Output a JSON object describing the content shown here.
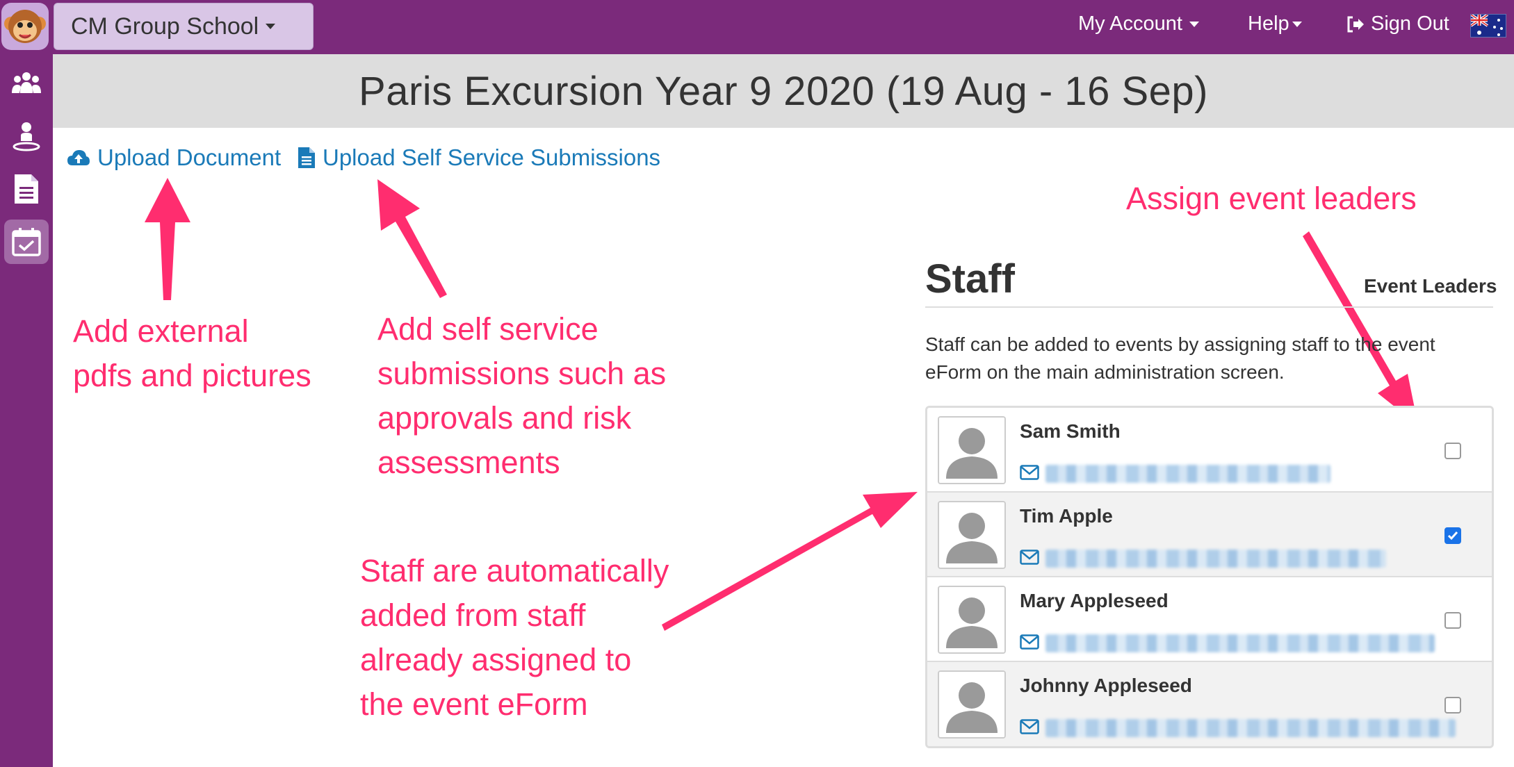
{
  "navbar": {
    "school_name": "CM Group School",
    "my_account": "My Account",
    "help": "Help",
    "sign_out": "Sign Out",
    "flag_icon": "australia-flag-icon"
  },
  "sidebar": {
    "items": [
      {
        "icon": "group-icon"
      },
      {
        "icon": "person-icon"
      },
      {
        "icon": "document-icon"
      },
      {
        "icon": "calendar-check-icon",
        "active": true
      }
    ]
  },
  "page": {
    "title": "Paris Excursion Year 9 2020 (19 Aug - 16 Sep)"
  },
  "actions": {
    "upload_document": "Upload Document",
    "upload_self_service": "Upload Self Service Submissions"
  },
  "annotations": {
    "external": [
      "Add external",
      "pdfs and pictures"
    ],
    "self_service": [
      "Add self service",
      "submissions such as",
      "approvals and risk",
      "assessments"
    ],
    "staff_auto": [
      "Staff are automatically",
      "added from staff",
      "already assigned to",
      "the event eForm"
    ],
    "leaders": [
      "Assign event leaders"
    ],
    "color": "#ff2d6f"
  },
  "staff": {
    "title": "Staff",
    "leaders_label": "Event Leaders",
    "description": "Staff can be added to events by assigning staff to the event eForm on the main administration screen.",
    "members": [
      {
        "name": "Sam Smith",
        "leader": false
      },
      {
        "name": "Tim Apple",
        "leader": true
      },
      {
        "name": "Mary Appleseed",
        "leader": false
      },
      {
        "name": "Johnny Appleseed",
        "leader": false
      }
    ]
  },
  "colors": {
    "brand_purple": "#7b2a7b",
    "link_blue": "#1a7ab8",
    "annotation_pink": "#ff2d6f"
  }
}
